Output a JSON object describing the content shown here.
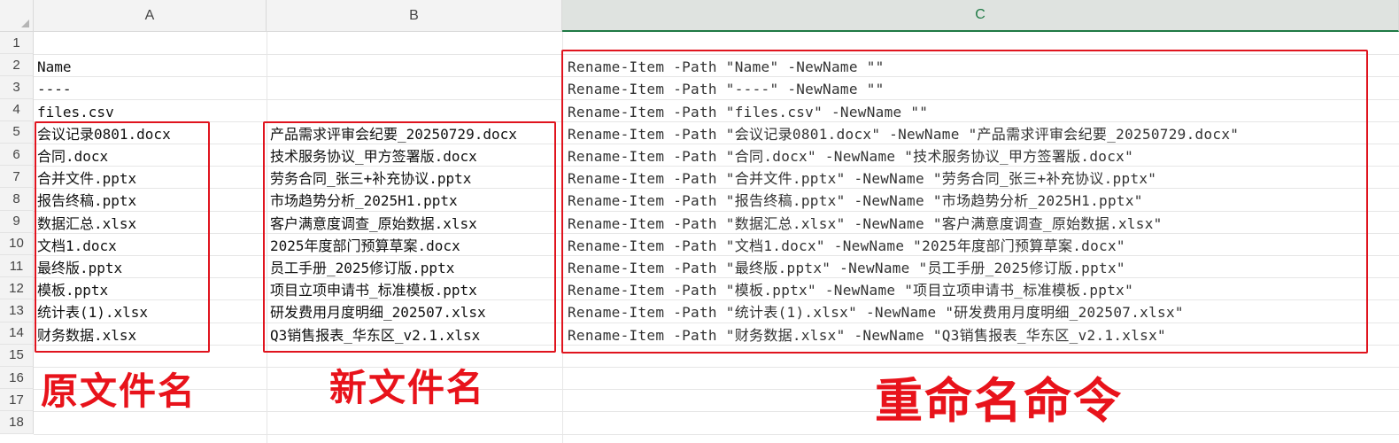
{
  "sheet": {
    "columns": [
      "A",
      "B",
      "C"
    ],
    "selected_column": "C",
    "rows": [
      "1",
      "2",
      "3",
      "4",
      "5",
      "6",
      "7",
      "8",
      "9",
      "10",
      "11",
      "12",
      "13",
      "14",
      "15",
      "16",
      "17",
      "18"
    ],
    "col_a": [
      "",
      "Name",
      "----",
      "files.csv",
      "会议记录0801.docx",
      "合同.docx",
      "合并文件.pptx",
      "报告终稿.pptx",
      "数据汇总.xlsx",
      "文档1.docx",
      "最终版.pptx",
      "模板.pptx",
      "统计表(1).xlsx",
      "财务数据.xlsx"
    ],
    "col_b": [
      "",
      "",
      "",
      "",
      "产品需求评审会纪要_20250729.docx",
      "技术服务协议_甲方签署版.docx",
      "劳务合同_张三+补充协议.pptx",
      "市场趋势分析_2025H1.pptx",
      "客户满意度调查_原始数据.xlsx",
      "2025年度部门预算草案.docx",
      "员工手册_2025修订版.pptx",
      "项目立项申请书_标准模板.pptx",
      "研发费用月度明细_202507.xlsx",
      "Q3销售报表_华东区_v2.1.xlsx"
    ],
    "col_c": [
      "",
      "Rename-Item -Path \"Name\" -NewName \"\"",
      "Rename-Item -Path \"----\" -NewName \"\"",
      "Rename-Item -Path \"files.csv\" -NewName \"\"",
      "Rename-Item -Path \"会议记录0801.docx\" -NewName \"产品需求评审会纪要_20250729.docx\"",
      "Rename-Item -Path \"合同.docx\" -NewName \"技术服务协议_甲方签署版.docx\"",
      "Rename-Item -Path \"合并文件.pptx\" -NewName \"劳务合同_张三+补充协议.pptx\"",
      "Rename-Item -Path \"报告终稿.pptx\" -NewName \"市场趋势分析_2025H1.pptx\"",
      "Rename-Item -Path \"数据汇总.xlsx\" -NewName \"客户满意度调查_原始数据.xlsx\"",
      "Rename-Item -Path \"文档1.docx\" -NewName \"2025年度部门预算草案.docx\"",
      "Rename-Item -Path \"最终版.pptx\" -NewName \"员工手册_2025修订版.pptx\"",
      "Rename-Item -Path \"模板.pptx\" -NewName \"项目立项申请书_标准模板.pptx\"",
      "Rename-Item -Path \"统计表(1).xlsx\" -NewName \"研发费用月度明细_202507.xlsx\"",
      "Rename-Item -Path \"财务数据.xlsx\" -NewName \"Q3销售报表_华东区_v2.1.xlsx\""
    ]
  },
  "annotations": {
    "original_name": "原文件名",
    "new_name": "新文件名",
    "rename_command": "重命名命令",
    "color": "#e0141e"
  }
}
